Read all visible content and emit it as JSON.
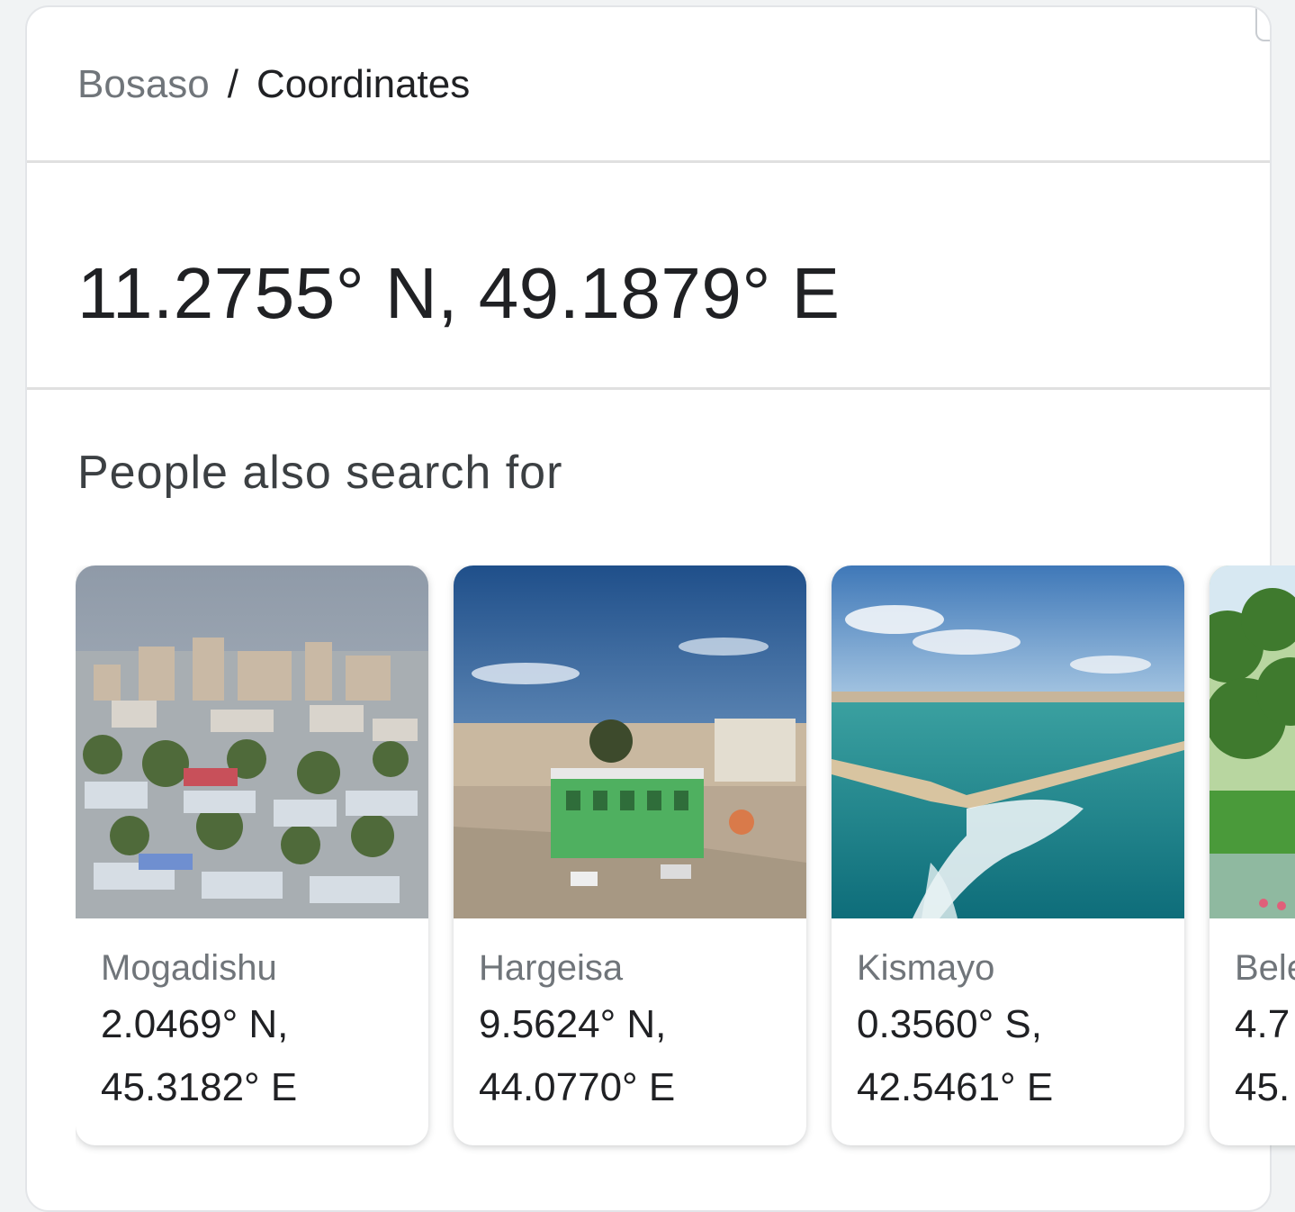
{
  "breadcrumb": {
    "parent": "Bosaso",
    "separator": "/",
    "current": "Coordinates"
  },
  "answer": {
    "coordinates": "11.2755° N, 49.1879° E"
  },
  "related": {
    "title": "People also search for",
    "cards": [
      {
        "name": "Mogadishu",
        "line1": "2.0469° N,",
        "line2": "45.3182° E",
        "image": "city-skyline-photo"
      },
      {
        "name": "Hargeisa",
        "line1": "9.5624° N,",
        "line2": "44.0770° E",
        "image": "city-street-photo"
      },
      {
        "name": "Kismayo",
        "line1": "0.3560° S,",
        "line2": "42.5461° E",
        "image": "coastal-harbor-photo"
      },
      {
        "name": "Bele",
        "line1": "4.7",
        "line2": "45.",
        "image": "riverside-trees-photo"
      }
    ]
  }
}
